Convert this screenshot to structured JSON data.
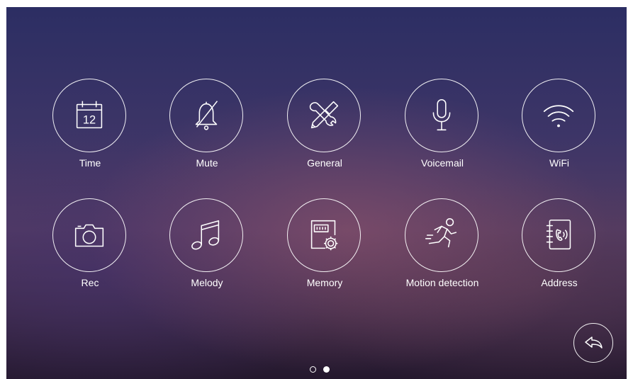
{
  "menu": {
    "items": [
      {
        "id": "time",
        "label": "Time",
        "icon": "calendar-icon",
        "icon_text": "12"
      },
      {
        "id": "mute",
        "label": "Mute",
        "icon": "bell-muted-icon"
      },
      {
        "id": "general",
        "label": "General",
        "icon": "tools-icon"
      },
      {
        "id": "voicemail",
        "label": "Voicemail",
        "icon": "microphone-icon"
      },
      {
        "id": "wifi",
        "label": "WiFi",
        "icon": "wifi-icon"
      },
      {
        "id": "rec",
        "label": "Rec",
        "icon": "camera-icon"
      },
      {
        "id": "melody",
        "label": "Melody",
        "icon": "music-note-icon"
      },
      {
        "id": "memory",
        "label": "Memory",
        "icon": "sd-card-settings-icon"
      },
      {
        "id": "motion-detection",
        "label": "Motion detection",
        "icon": "running-person-icon"
      },
      {
        "id": "address",
        "label": "Address",
        "icon": "address-book-icon"
      }
    ]
  },
  "back_button": {
    "icon": "back-arrow-icon"
  },
  "pager": {
    "pages": 2,
    "current_page": 2
  },
  "colors": {
    "foreground": "#ffffff",
    "background_top": "#2c2e63",
    "background_mid": "#523b62",
    "background_bottom": "#24182d"
  }
}
